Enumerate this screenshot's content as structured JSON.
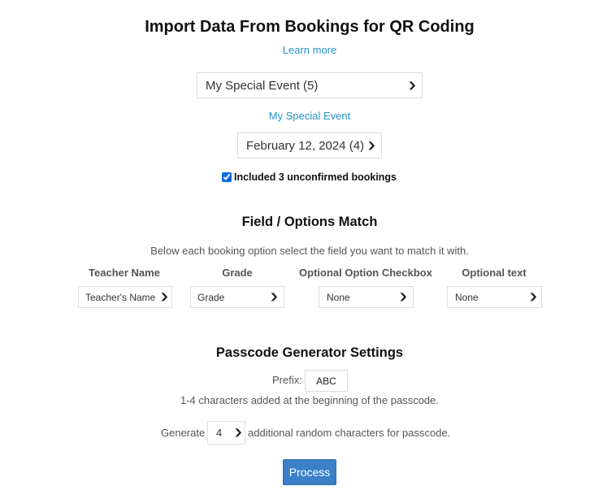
{
  "title": "Import Data From Bookings for QR Coding",
  "learn_more": "Learn more",
  "event_select": {
    "value": "My Special Event (5)"
  },
  "event_link": "My Special Event",
  "date_select": {
    "value": "February 12, 2024 (4)"
  },
  "unconfirmed": {
    "checked": true,
    "label": "Included 3 unconfirmed bookings"
  },
  "field_match": {
    "title": "Field / Options Match",
    "description": "Below each booking option select the field you want to match it with.",
    "columns": [
      {
        "header": "Teacher Name",
        "value": "Teacher's Name"
      },
      {
        "header": "Grade",
        "value": "Grade"
      },
      {
        "header": "Optional Option Checkbox",
        "value": "None"
      },
      {
        "header": "Optional text",
        "value": "None"
      }
    ]
  },
  "passcode": {
    "title": "Passcode Generator Settings",
    "prefix_label": "Prefix:",
    "prefix_value": "ABC",
    "prefix_hint": "1-4 characters added at the beginning of the passcode.",
    "generate_label": "Generate",
    "generate_value": "4",
    "generate_suffix": "additional random characters for passcode."
  },
  "process_button": "Process",
  "colors": {
    "link": "#2393c9",
    "button": "#3a80c9"
  }
}
